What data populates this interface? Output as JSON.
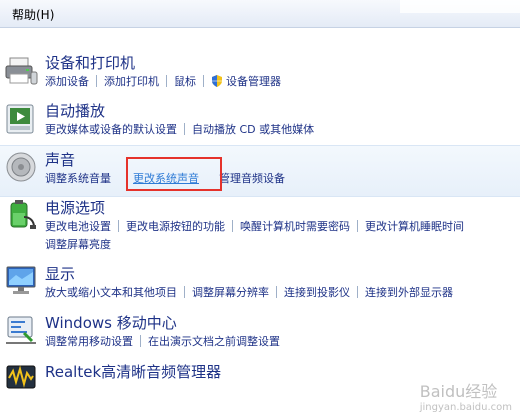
{
  "menubar": {
    "help": "帮助(H)"
  },
  "sections": [
    {
      "title": "设备和打印机",
      "links": [
        "添加设备",
        "添加打印机",
        "鼠标",
        "设备管理器"
      ]
    },
    {
      "title": "自动播放",
      "links": [
        "更改媒体或设备的默认设置",
        "自动播放 CD 或其他媒体"
      ]
    },
    {
      "title": "声音",
      "links": [
        "调整系统音量",
        "更改系统声音",
        "管理音频设备"
      ]
    },
    {
      "title": "电源选项",
      "links": [
        "更改电池设置",
        "更改电源按钮的功能",
        "唤醒计算机时需要密码",
        "更改计算机睡眠时间"
      ],
      "links2": [
        "调整屏幕亮度"
      ]
    },
    {
      "title": "显示",
      "links": [
        "放大或缩小文本和其他项目",
        "调整屏幕分辨率",
        "连接到投影仪",
        "连接到外部显示器"
      ]
    },
    {
      "title": "Windows 移动中心",
      "links": [
        "调整常用移动设置",
        "在出演示文档之前调整设置"
      ]
    },
    {
      "title": "Realtek高清晰音频管理器"
    }
  ],
  "watermark": "Baidu经验",
  "watermark_sub": "jingyan.baidu.com",
  "colors": {
    "link": "#1e3287",
    "highlight_box": "#e5322b",
    "hover_link": "#2e7bd6"
  }
}
